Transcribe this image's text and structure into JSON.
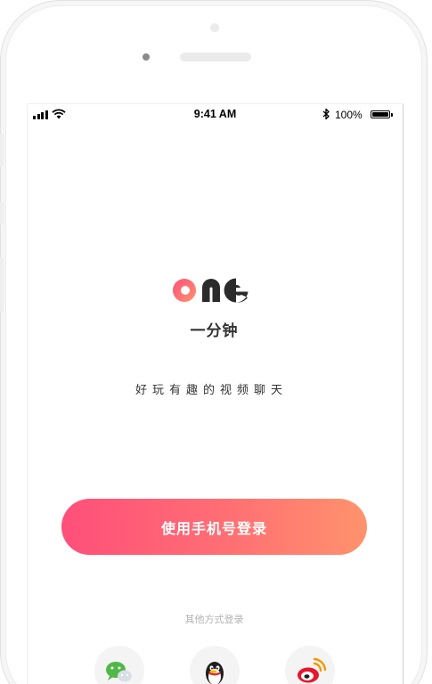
{
  "status_bar": {
    "time": "9:41 AM",
    "battery": "100%"
  },
  "app": {
    "logo_text": "one",
    "name": "一分钟",
    "tagline": "好玩有趣的视频聊天"
  },
  "login": {
    "phone_login_label": "使用手机号登录",
    "other_methods_label": "其他方式登录",
    "options": [
      {
        "name": "wechat",
        "icon": "wechat-icon"
      },
      {
        "name": "qq",
        "icon": "qq-icon"
      },
      {
        "name": "weibo",
        "icon": "weibo-icon"
      }
    ]
  },
  "colors": {
    "accent_start": "#ff4f7a",
    "accent_end": "#ff936c",
    "logo_dark": "#2b2b2b"
  }
}
